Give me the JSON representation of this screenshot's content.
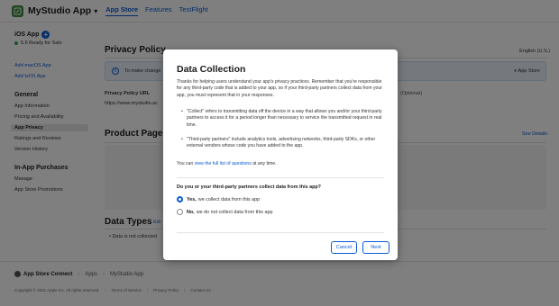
{
  "header": {
    "app_name": "MyStudio App",
    "tabs": [
      {
        "label": "App Store",
        "active": true
      },
      {
        "label": "Features",
        "active": false
      },
      {
        "label": "TestFlight",
        "active": false
      }
    ]
  },
  "sidebar": {
    "platform": "iOS App",
    "status": "5.6 Ready for Sale",
    "add_macos": "Add macOS App",
    "add_tvos": "Add tvOS App",
    "general_heading": "General",
    "general_items": [
      "App Information",
      "Pricing and Availability",
      "App Privacy",
      "Ratings and Reviews",
      "Version History"
    ],
    "iap_heading": "In-App Purchases",
    "iap_items": [
      "Manage",
      "App Store Promotions"
    ]
  },
  "main": {
    "privacy_heading": "Privacy Policy",
    "language": "English (U.S.)",
    "info_text": "To make change",
    "info_right": "e App Store",
    "privacy_url_label": "Privacy Policy URL",
    "privacy_url_value": "https://www.mystudio.ac",
    "optional": "(Optional)",
    "preview_heading": "Product Page P",
    "see_details": "See Details",
    "types_heading": "Data Types",
    "types_edit": "Edi",
    "types_item": "• Data is not collected"
  },
  "footer": {
    "brand": "App Store Connect",
    "crumbs": [
      "Apps",
      "MyStudio App"
    ],
    "copyright": "Copyright © 2021 Apple Inc. All rights reserved.",
    "links": [
      "Terms of Service",
      "Privacy Policy",
      "Contact Us"
    ]
  },
  "modal": {
    "title": "Data Collection",
    "intro": "Thanks for helping users understand your app's privacy practices. Remember that you're responsible for any third-party code that is added to your app, so if your third-party partners collect data from your app, you must represent that in your responses.",
    "bullet_1": "\"Collect\" refers to transmitting data off the device in a way that allows you and/or your third-party partners to access it for a period longer than necessary to service the transmitted request in real time.",
    "bullet_2": "\"Third-party partners\" include analytics tools, advertising networks, third-party SDKs, or other external vendors whose code you have added to the app.",
    "learn_prefix": "You can ",
    "learn_link": "view the full list of questions",
    "learn_suffix": " at any time.",
    "question": "Do you or your third-party partners collect data from this app?",
    "option_yes_bold": "Yes,",
    "option_yes_rest": "we collect data from this app",
    "option_no_bold": "No,",
    "option_no_rest": "we do not collect data from this app",
    "selected": "yes",
    "cancel_label": "Cancel",
    "next_label": "Next"
  },
  "colors": {
    "accent": "#0a5bd5",
    "status_green": "#2fa84f",
    "app_icon": "#3a8f3f"
  }
}
